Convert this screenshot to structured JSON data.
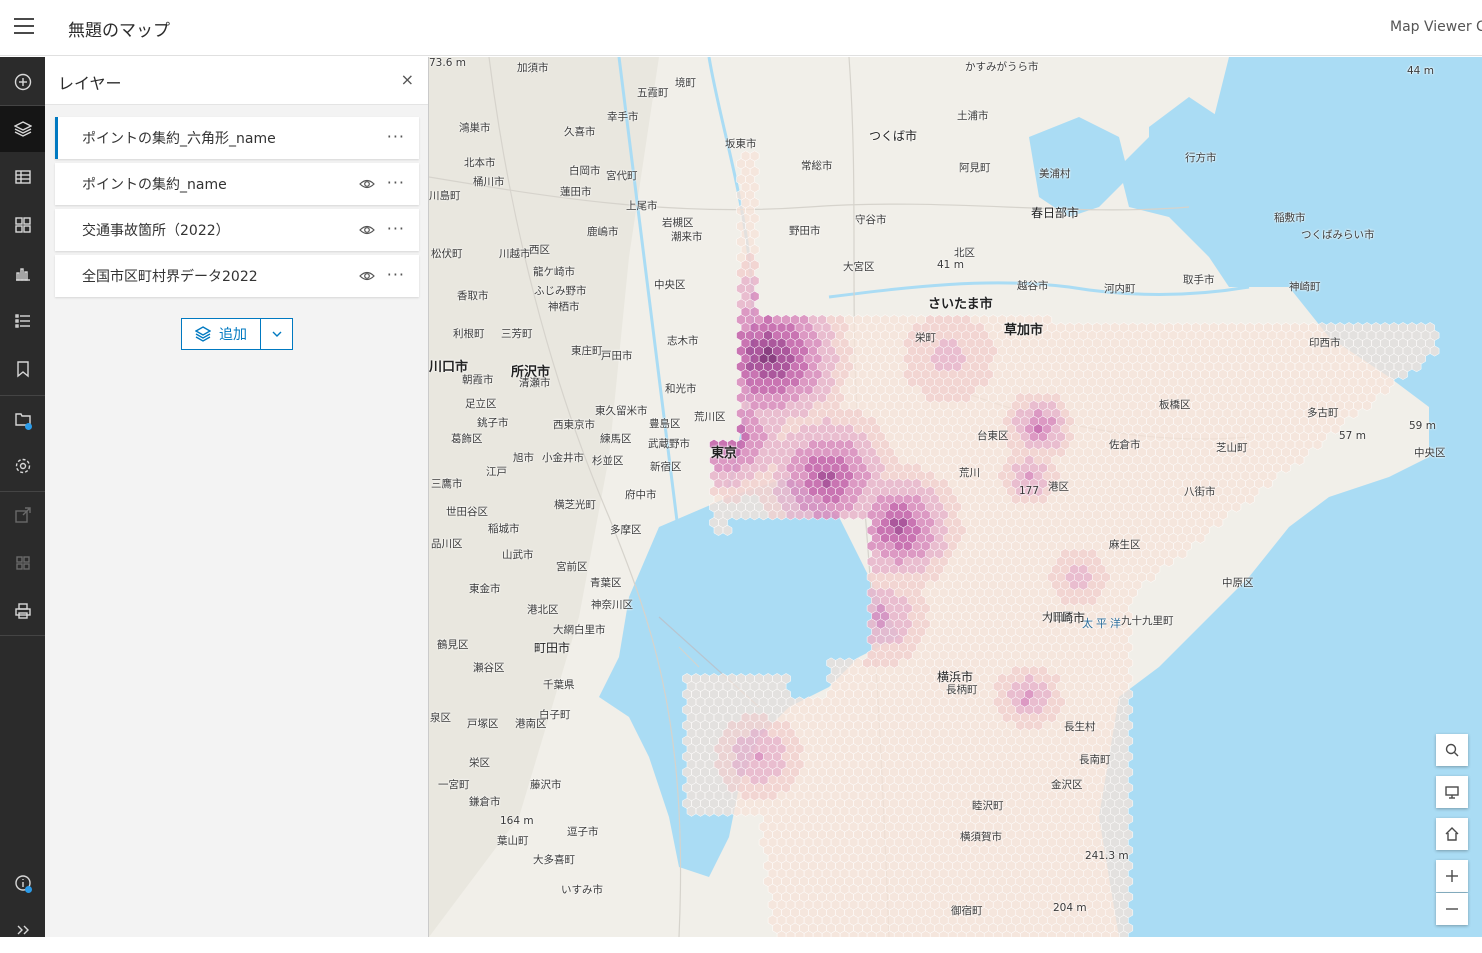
{
  "header": {
    "title": "無題のマップ",
    "brand": "Map Viewer C"
  },
  "toolbar": {
    "items": [
      "add-icon",
      "layers-icon",
      "table-icon",
      "basemap-icon",
      "chart-icon",
      "legend-icon",
      "bookmark-icon",
      "folder-icon",
      "settings-icon",
      "share-icon",
      "apps-icon",
      "print-icon",
      "info-icon",
      "expand-icon"
    ]
  },
  "panel": {
    "title": "レイヤー",
    "close": "×",
    "layers": [
      {
        "name": "ポイントの集約_六角形_name",
        "visible_icon": false
      },
      {
        "name": "ポイントの集約_name",
        "visible_icon": true
      },
      {
        "name": "交通事故箇所（2022）",
        "visible_icon": true
      },
      {
        "name": "全国市区町村界データ2022",
        "visible_icon": true
      }
    ],
    "more": "···",
    "add_label": "追加"
  },
  "map": {
    "labels": [
      {
        "t": "加須市",
        "c": ""
      },
      {
        "t": "境町",
        "c": ""
      },
      {
        "t": "かすみがうら市",
        "c": ""
      },
      {
        "t": "44 m",
        "c": ""
      },
      {
        "t": "五霞町",
        "c": ""
      },
      {
        "t": "幸手市",
        "c": ""
      },
      {
        "t": "土浦市",
        "c": ""
      },
      {
        "t": "鴻巣市",
        "c": ""
      },
      {
        "t": "久喜市",
        "c": ""
      },
      {
        "t": "坂東市",
        "c": ""
      },
      {
        "t": "つくば市",
        "c": "mid"
      },
      {
        "t": "北本市",
        "c": ""
      },
      {
        "t": "白岡市",
        "c": ""
      },
      {
        "t": "常総市",
        "c": ""
      },
      {
        "t": "阿見町",
        "c": ""
      },
      {
        "t": "行方市",
        "c": ""
      },
      {
        "t": "桶川市",
        "c": ""
      },
      {
        "t": "宮代町",
        "c": ""
      },
      {
        "t": "美浦村",
        "c": ""
      },
      {
        "t": "川島町",
        "c": ""
      },
      {
        "t": "蓮田市",
        "c": ""
      },
      {
        "t": "上尾市",
        "c": ""
      },
      {
        "t": "春日部市",
        "c": "mid"
      },
      {
        "t": "稲敷市",
        "c": ""
      },
      {
        "t": "鹿嶋市",
        "c": ""
      },
      {
        "t": "岩槻区",
        "c": ""
      },
      {
        "t": "野田市",
        "c": ""
      },
      {
        "t": "守谷市",
        "c": ""
      },
      {
        "t": "つくばみらい市",
        "c": ""
      },
      {
        "t": "潮来市",
        "c": ""
      },
      {
        "t": "松伏町",
        "c": ""
      },
      {
        "t": "川越市",
        "c": ""
      },
      {
        "t": "西区",
        "c": ""
      },
      {
        "t": "北区",
        "c": ""
      },
      {
        "t": "41 m",
        "c": ""
      },
      {
        "t": "龍ケ崎市",
        "c": ""
      },
      {
        "t": "大宮区",
        "c": ""
      },
      {
        "t": "取手市",
        "c": ""
      },
      {
        "t": "香取市",
        "c": ""
      },
      {
        "t": "ふじみ野市",
        "c": ""
      },
      {
        "t": "中央区",
        "c": ""
      },
      {
        "t": "越谷市",
        "c": ""
      },
      {
        "t": "河内町",
        "c": ""
      },
      {
        "t": "神崎町",
        "c": ""
      },
      {
        "t": "神栖市",
        "c": ""
      },
      {
        "t": "さいたま市",
        "c": "big"
      },
      {
        "t": "利根町",
        "c": ""
      },
      {
        "t": "三芳町",
        "c": ""
      },
      {
        "t": "志木市",
        "c": ""
      },
      {
        "t": "草加市",
        "c": "big"
      },
      {
        "t": "栄町",
        "c": ""
      },
      {
        "t": "印西市",
        "c": ""
      },
      {
        "t": "東庄町",
        "c": ""
      },
      {
        "t": "戸田市",
        "c": ""
      },
      {
        "t": "川口市",
        "c": "big"
      },
      {
        "t": "所沢市",
        "c": "big"
      },
      {
        "t": "朝霞市",
        "c": ""
      },
      {
        "t": "清瀬市",
        "c": ""
      },
      {
        "t": "和光市",
        "c": ""
      },
      {
        "t": "足立区",
        "c": ""
      },
      {
        "t": "東久留米市",
        "c": ""
      },
      {
        "t": "板橋区",
        "c": ""
      },
      {
        "t": "多古町",
        "c": ""
      },
      {
        "t": "57 m",
        "c": ""
      },
      {
        "t": "59 m",
        "c": ""
      },
      {
        "t": "銚子市",
        "c": ""
      },
      {
        "t": "西東京市",
        "c": ""
      },
      {
        "t": "練馬区",
        "c": ""
      },
      {
        "t": "豊島区",
        "c": ""
      },
      {
        "t": "荒川区",
        "c": ""
      },
      {
        "t": "葛飾区",
        "c": ""
      },
      {
        "t": "武蔵野市",
        "c": ""
      },
      {
        "t": "台東区",
        "c": ""
      },
      {
        "t": "佐倉市",
        "c": ""
      },
      {
        "t": "芝山町",
        "c": ""
      },
      {
        "t": "旭市",
        "c": ""
      },
      {
        "t": "小金井市",
        "c": ""
      },
      {
        "t": "杉並区",
        "c": ""
      },
      {
        "t": "新宿区",
        "c": ""
      },
      {
        "t": "東京",
        "c": "big"
      },
      {
        "t": "江戸",
        "c": ""
      },
      {
        "t": "三鷹市",
        "c": ""
      },
      {
        "t": "府中市",
        "c": ""
      },
      {
        "t": "港区",
        "c": ""
      },
      {
        "t": "八街市",
        "c": ""
      },
      {
        "t": "横芝光町",
        "c": ""
      },
      {
        "t": "世田谷区",
        "c": ""
      },
      {
        "t": "稲城市",
        "c": ""
      },
      {
        "t": "多摩区",
        "c": ""
      },
      {
        "t": "品川区",
        "c": ""
      },
      {
        "t": "麻生区",
        "c": ""
      },
      {
        "t": "山武市",
        "c": ""
      },
      {
        "t": "宮前区",
        "c": ""
      },
      {
        "t": "中原区",
        "c": ""
      },
      {
        "t": "東金市",
        "c": ""
      },
      {
        "t": "太平洋",
        "c": "sea"
      },
      {
        "t": "大田区",
        "c": ""
      },
      {
        "t": "青葉区",
        "c": ""
      },
      {
        "t": "川崎市",
        "c": "mid"
      },
      {
        "t": "港北区",
        "c": ""
      },
      {
        "t": "九十九里町",
        "c": ""
      },
      {
        "t": "大網白里市",
        "c": ""
      },
      {
        "t": "鶴見区",
        "c": ""
      },
      {
        "t": "町田市",
        "c": "mid"
      },
      {
        "t": "神奈川区",
        "c": ""
      },
      {
        "t": "瀬谷区",
        "c": ""
      },
      {
        "t": "千葉県",
        "c": ""
      },
      {
        "t": "横浜市",
        "c": "mid"
      },
      {
        "t": "長柄町",
        "c": ""
      },
      {
        "t": "白子町",
        "c": ""
      },
      {
        "t": "泉区",
        "c": ""
      },
      {
        "t": "戸塚区",
        "c": ""
      },
      {
        "t": "港南区",
        "c": ""
      },
      {
        "t": "長生村",
        "c": ""
      },
      {
        "t": "長南町",
        "c": ""
      },
      {
        "t": "栄区",
        "c": ""
      },
      {
        "t": "一宮町",
        "c": ""
      },
      {
        "t": "藤沢市",
        "c": ""
      },
      {
        "t": "金沢区",
        "c": ""
      },
      {
        "t": "睦沢町",
        "c": ""
      },
      {
        "t": "鎌倉市",
        "c": ""
      },
      {
        "t": "164 m",
        "c": ""
      },
      {
        "t": "逗子市",
        "c": ""
      },
      {
        "t": "横須賀市",
        "c": ""
      },
      {
        "t": "葉山町",
        "c": ""
      },
      {
        "t": "大多喜町",
        "c": ""
      },
      {
        "t": "241.3 m",
        "c": ""
      },
      {
        "t": "いすみ市",
        "c": ""
      },
      {
        "t": "204 m",
        "c": ""
      },
      {
        "t": "御宿町",
        "c": ""
      },
      {
        "t": "177",
        "c": ""
      },
      {
        "t": "荒川",
        "c": ""
      },
      {
        "t": "中央区",
        "c": ""
      },
      {
        "t": "73.6 m",
        "c": ""
      }
    ]
  },
  "map_controls": [
    "search-icon",
    "screen-icon",
    "home-icon",
    "zoom-in-icon",
    "zoom-out-icon"
  ]
}
